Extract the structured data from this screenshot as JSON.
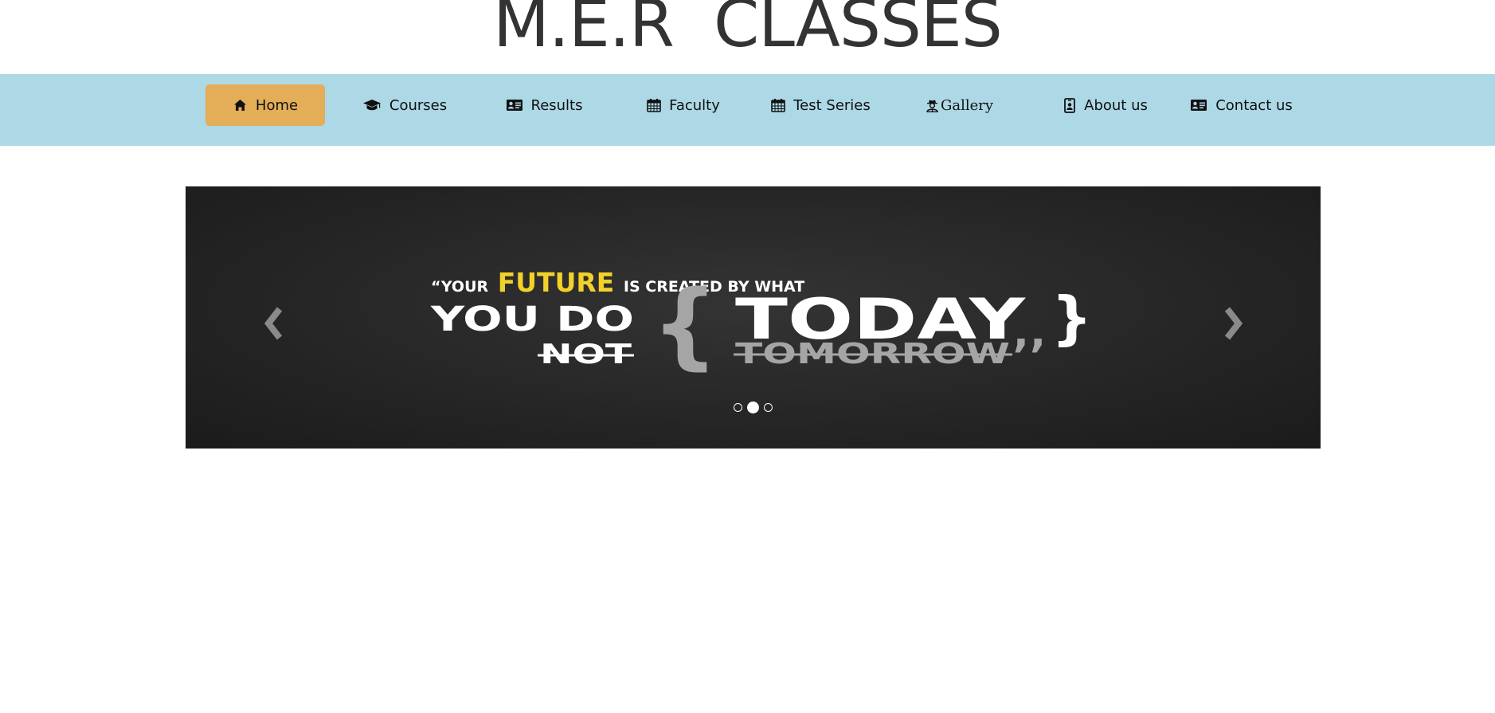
{
  "site": {
    "title": "M.E.R  CLASSES"
  },
  "nav": {
    "items": [
      {
        "label": "Home",
        "icon": "home-icon",
        "active": true
      },
      {
        "label": "Courses",
        "icon": "graduation-cap-icon"
      },
      {
        "label": "Results",
        "icon": "id-card-icon"
      },
      {
        "label": "Faculty",
        "icon": "calendar-icon"
      },
      {
        "label": "Test Series",
        "icon": "calendar-icon"
      },
      {
        "label": "Gallery",
        "icon": "user-secret-icon"
      },
      {
        "label": "About us",
        "icon": "id-badge-icon"
      },
      {
        "label": "Contact us",
        "icon": "address-card-icon"
      }
    ]
  },
  "carousel": {
    "slide": {
      "line1_a": "“YOUR",
      "line1_b": "FUTURE",
      "line1_c": "IS CREATED BY WHAT",
      "line2": "YOU DO",
      "not": "NOT",
      "open_brace": "{",
      "today": "TODAY",
      "close_brace": "}",
      "tomorrow": "TOMORROW",
      "close_quote": "’’"
    },
    "prev_icon": "chevron-left-icon",
    "next_icon": "chevron-right-icon",
    "indicator_count": 3,
    "active_indicator": 2
  },
  "colors": {
    "title": "#333333",
    "navbar_bg": "#add8e6",
    "active_tab_bg": "#e4ad57",
    "carousel_bg": "#262626",
    "quote_highlight": "#f2d129",
    "quote_gray": "#a5a5a5"
  }
}
